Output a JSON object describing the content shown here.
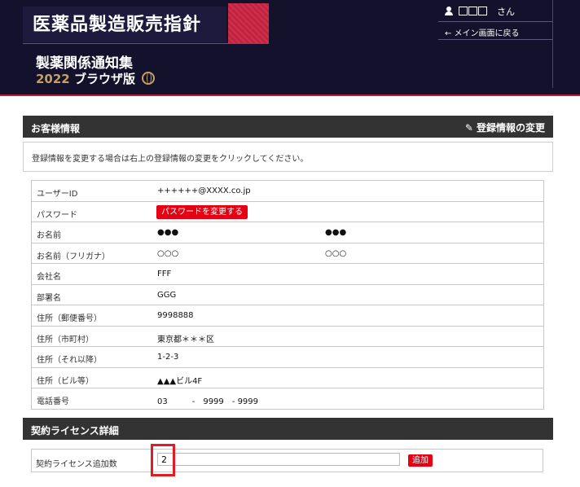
{
  "header": {
    "title": "医薬品製造販売指針",
    "subtitle": "製薬関係通知集",
    "year": "2022",
    "edition_label": "ブラウザ版",
    "user_name_suffix": "さん",
    "back_link": "← メイン画面に戻る"
  },
  "customer_section": {
    "title": "お客様情報",
    "edit_link": "登録情報の変更",
    "notice": "登録情報を変更する場合は右上の登録情報の変更をクリックしてください。",
    "rows": [
      {
        "label": "ユーザーID",
        "value": "++++++@XXXX.co.jp",
        "value2": ""
      },
      {
        "label": "パスワード",
        "button": "パスワードを変更する"
      },
      {
        "label": "お名前",
        "value": "●●●",
        "value2": "●●●"
      },
      {
        "label": "お名前（フリガナ）",
        "value": "○○○",
        "value2": "○○○"
      },
      {
        "label": "会社名",
        "value": "FFF",
        "value2": ""
      },
      {
        "label": "部署名",
        "value": "GGG",
        "value2": ""
      },
      {
        "label": "住所（郵便番号）",
        "value": "9998888",
        "value2": ""
      },
      {
        "label": "住所（市町村）",
        "value": "東京都＊＊＊区",
        "value2": ""
      },
      {
        "label": "住所（それ以降）",
        "value": "1-2-3",
        "value2": ""
      },
      {
        "label": "住所（ビル等）",
        "value": "▲▲▲ビル4F",
        "value2": ""
      },
      {
        "label": "電話番号",
        "value": "03　　　-　9999　- 9999",
        "value2": ""
      }
    ]
  },
  "license_section": {
    "title": "契約ライセンス詳細",
    "label": "契約ライセンス追加数",
    "input_value": "2",
    "add_button": "追加"
  },
  "colors": {
    "header_bg": "#13112b",
    "accent_red": "#e60012",
    "section_bar": "#333333",
    "gold": "#c6a060"
  }
}
